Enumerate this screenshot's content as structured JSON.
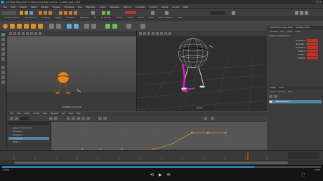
{
  "window": {
    "title": "Autodesk Maya 2018.3: Walk_Cycle_Ball_v03.ma — ballbot_walk_cycle",
    "controls": "— ❐ ✕"
  },
  "menu": [
    "File",
    "Edit",
    "Create",
    "Select",
    "Modify",
    "Display",
    "Windows",
    "Key",
    "Playback",
    "Audio",
    "Visualize",
    "Deform",
    "Constrain",
    "Control",
    "Cache",
    "Arnold",
    "Help"
  ],
  "shelf_tabs": [
    "Curves / Surfaces",
    "Poly Modeling",
    "Sculpting",
    "Rigging",
    "Animation",
    "Rendering",
    "FX",
    "FX Caching",
    "Custom",
    "Arnold",
    "Bifrost",
    "MASH",
    "Motion Graphics",
    "XGen"
  ],
  "viewports": {
    "left_label": "CamBall (camera1)",
    "right_label": "persp"
  },
  "right_panel": {
    "tabs": [
      "Channel Box / Layer Editor",
      "Modeling Toolkit"
    ],
    "menu": [
      "Channels",
      "Edit",
      "Object",
      "Show"
    ],
    "object_name": "walker_rt_foot_fk_ctrl",
    "channels": [
      {
        "label": "Translate X"
      },
      {
        "label": "Translate Y"
      },
      {
        "label": "Translate Z"
      },
      {
        "label": "Rotate X"
      },
      {
        "label": "Rotate Y"
      },
      {
        "label": "Rotate Z"
      }
    ],
    "layer_tabs": [
      "Display",
      "Anim"
    ],
    "layer_menu": [
      "Layers",
      "Options",
      "Help"
    ],
    "layer_name": "BaseAnimation"
  },
  "graph_editor": {
    "menu": [
      "Edit",
      "View",
      "Select",
      "Curves",
      "Keys",
      "Tangents",
      "List",
      "Show",
      "Help"
    ],
    "outliner_items": [
      "walker_rt_foot_fk_ctrl",
      "Translate X",
      "Translate Y",
      "Translate Z",
      "Rotate X"
    ],
    "curve_color": "#d98e2a"
  },
  "player": {
    "time_current": "14:03",
    "time_total": "17:52",
    "progress": 0.79
  }
}
